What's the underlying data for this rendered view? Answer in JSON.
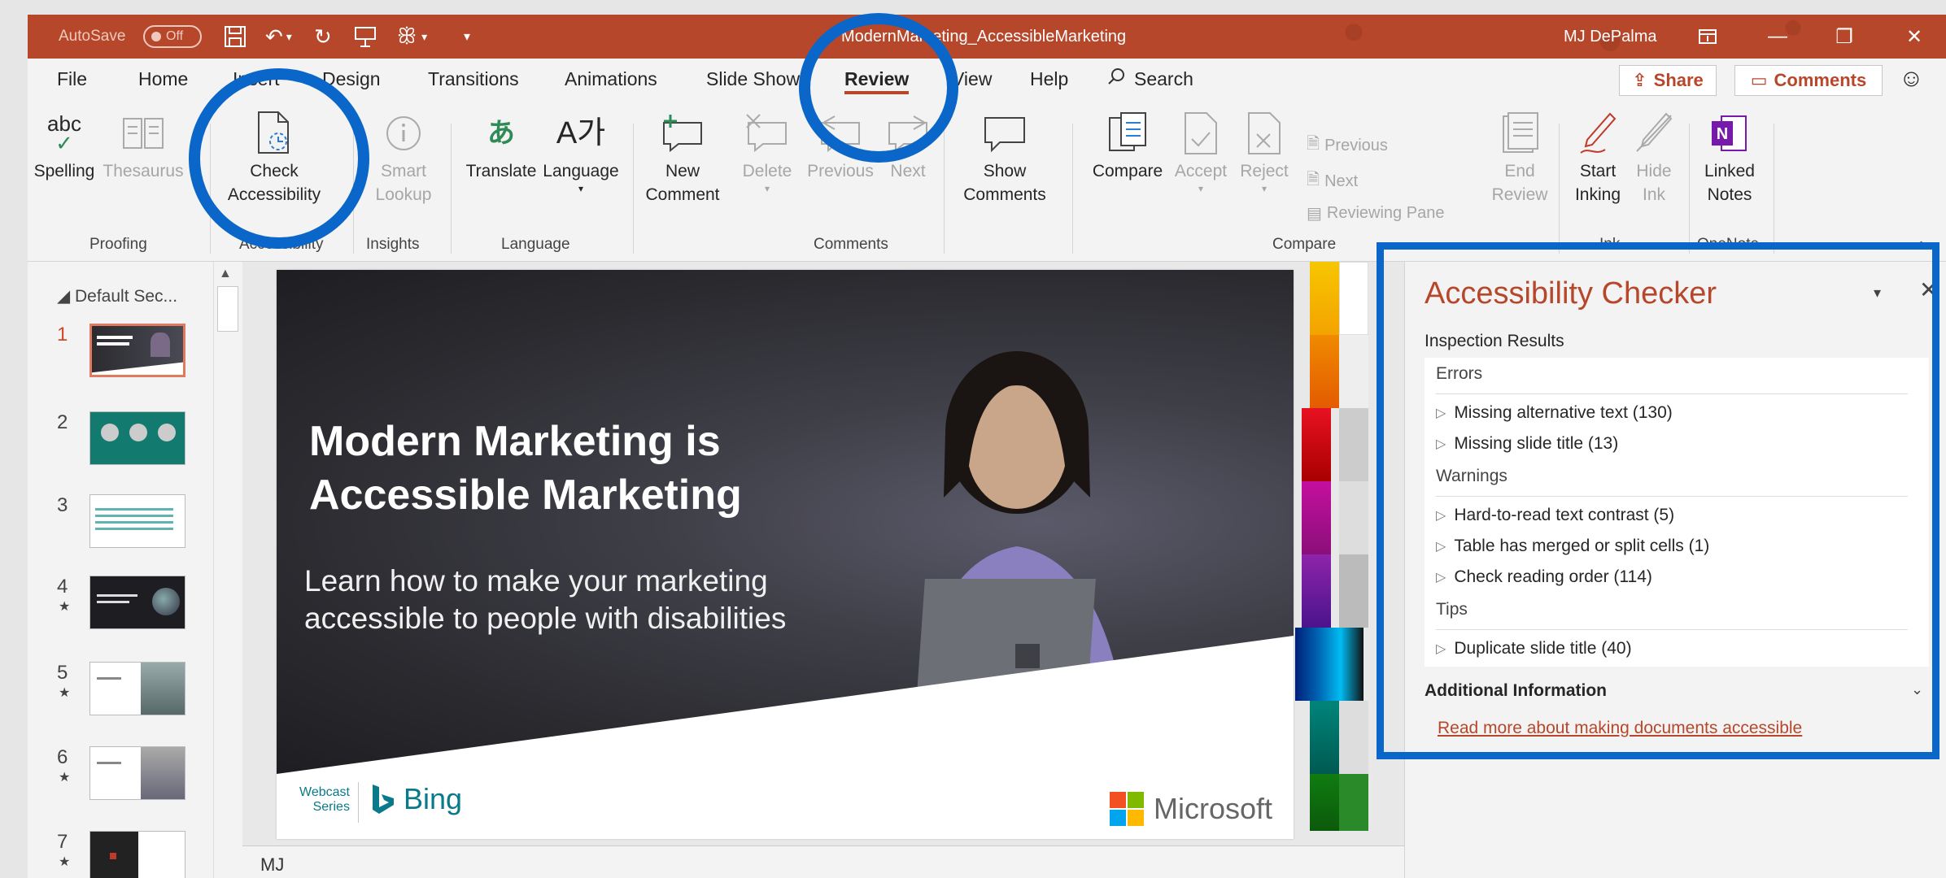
{
  "titlebar": {
    "autosave_label": "AutoSave",
    "autosave_state": "Off",
    "doc_title": "ModernMarketing_AccessibleMarketing",
    "user": "MJ DePalma",
    "qat_icons": [
      "save-icon",
      "undo-icon",
      "redo-icon",
      "present-icon",
      "customize-icon"
    ]
  },
  "tabs": [
    "File",
    "Home",
    "Insert",
    "Design",
    "Transitions",
    "Animations",
    "Slide Show",
    "Review",
    "View",
    "Help"
  ],
  "active_tab": "Review",
  "search_label": "Search",
  "share_label": "Share",
  "comments_label": "Comments",
  "ribbon": {
    "proofing": {
      "label": "Proofing",
      "spelling": "Spelling",
      "thesaurus": "Thesaurus",
      "abc": "abc"
    },
    "accessibility": {
      "label": "Accessibility",
      "check": "Check Accessibility",
      "check_line1": "Check",
      "check_line2": "Accessibility"
    },
    "insights": {
      "label": "Insights",
      "smart_line1": "Smart",
      "smart_line2": "Lookup"
    },
    "language": {
      "label": "Language",
      "translate": "Translate",
      "language": "Language"
    },
    "comments": {
      "label": "Comments",
      "new_line1": "New",
      "new_line2": "Comment",
      "delete": "Delete",
      "previous": "Previous",
      "next": "Next",
      "show_line1": "Show",
      "show_line2": "Comments"
    },
    "compare": {
      "label": "Compare",
      "compare": "Compare",
      "accept": "Accept",
      "reject": "Reject",
      "previous": "Previous",
      "next": "Next",
      "reviewing_pane": "Reviewing Pane",
      "end_line1": "End",
      "end_line2": "Review"
    },
    "ink": {
      "label": "Ink",
      "start_line1": "Start",
      "start_line2": "Inking",
      "hide_line1": "Hide",
      "hide_line2": "Ink"
    },
    "onenote": {
      "label": "OneNote",
      "linked_line1": "Linked",
      "linked_line2": "Notes"
    }
  },
  "thumbnails": {
    "section": "Default Sec...",
    "slides": [
      {
        "num": "1",
        "starred": false,
        "selected": true
      },
      {
        "num": "2",
        "starred": false,
        "selected": false
      },
      {
        "num": "3",
        "starred": false,
        "selected": false
      },
      {
        "num": "4",
        "starred": true,
        "selected": false
      },
      {
        "num": "5",
        "starred": true,
        "selected": false
      },
      {
        "num": "6",
        "starred": true,
        "selected": false
      },
      {
        "num": "7",
        "starred": true,
        "selected": false
      }
    ],
    "star_glyph": "★"
  },
  "slide": {
    "title_line1": "Modern Marketing is",
    "title_line2": "Accessible Marketing",
    "subtitle_line1": "Learn how to make your marketing",
    "subtitle_line2": "accessible to people with disabilities",
    "webcast_line1": "Webcast",
    "webcast_line2": "Series",
    "bing": "Bing",
    "microsoft": "Microsoft"
  },
  "notes_text": "MJ",
  "accessibility_checker": {
    "title": "Accessibility Checker",
    "inspection_results": "Inspection Results",
    "errors_label": "Errors",
    "errors": [
      "Missing alternative text (130)",
      "Missing slide title (13)"
    ],
    "warnings_label": "Warnings",
    "warnings": [
      "Hard-to-read text contrast (5)",
      "Table has merged or split cells (1)",
      "Check reading order (114)"
    ],
    "tips_label": "Tips",
    "tips": [
      "Duplicate slide title (40)"
    ],
    "additional_info": "Additional Information",
    "link": "Read more about making documents accessible"
  },
  "colors": {
    "accent": "#b7472a",
    "highlight": "#0a67c9"
  }
}
